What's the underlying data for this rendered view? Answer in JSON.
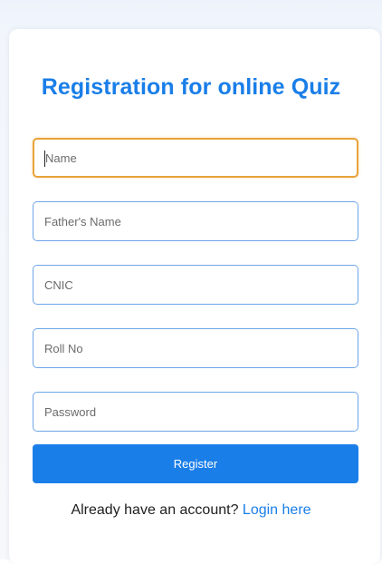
{
  "form": {
    "title": "Registration for online Quiz",
    "fields": [
      {
        "name": "name",
        "placeholder": "Name",
        "value": ""
      },
      {
        "name": "fathers_name",
        "placeholder": "Father's Name",
        "value": ""
      },
      {
        "name": "cnic",
        "placeholder": "CNIC",
        "value": ""
      },
      {
        "name": "roll_no",
        "placeholder": "Roll No",
        "value": ""
      },
      {
        "name": "password",
        "placeholder": "Password",
        "value": ""
      }
    ],
    "submit_label": "Register"
  },
  "footer": {
    "prompt_text": "Already have an account?",
    "login_link_label": "Login here"
  },
  "colors": {
    "accent": "#1a7ee8",
    "focus_border": "#e8a33a",
    "field_border": "#6ea6e8"
  }
}
